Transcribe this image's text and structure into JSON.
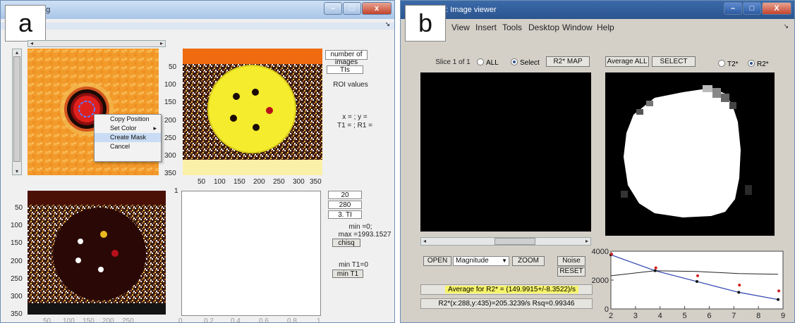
{
  "panel_a": {
    "label": "a",
    "title_fragment": "ng",
    "toolbar_fragment": ":",
    "context_menu": [
      "Copy Position",
      "Set Color",
      "Create Mask",
      "Cancel"
    ],
    "context_menu_arrow": "▸",
    "right": {
      "number_of_images": "number of images",
      "tis": "TIs",
      "roi_values": "ROI values",
      "xy": "x = ; y =",
      "t1r1": "T1 = ; R1 =",
      "box1": "20",
      "box2": "280",
      "box3": "3. TI",
      "min": "min =0;",
      "max": "max =1993.1527",
      "chisq": "chisq",
      "min_t1_text": "min T1=0",
      "min_t1_btn": "min T1"
    },
    "axis_top_y": [
      "50",
      "100",
      "150",
      "200",
      "250",
      "300",
      "350"
    ],
    "axis_top_x": [
      "50",
      "100",
      "150",
      "200",
      "250",
      "300",
      "350"
    ],
    "axis_bot_y": [
      "50",
      "100",
      "150",
      "200",
      "250",
      "300",
      "350"
    ],
    "axis_bot_x": [
      "50",
      "100",
      "150",
      "200",
      "250"
    ],
    "axis_plot_y": [
      "1"
    ],
    "axis_plot_x": [
      "0",
      "0.2",
      "0.4",
      "0.6",
      "0.8",
      "1"
    ]
  },
  "panel_b": {
    "label": "b",
    "title": "1: Image viewer",
    "menu": [
      "t",
      "View",
      "Insert",
      "Tools",
      "Desktop",
      "Window",
      "Help"
    ],
    "slice": "Slice 1 of 1",
    "all": "ALL",
    "select": "Select",
    "r2map": "R2* MAP",
    "average_all": "Average ALL",
    "select_btn": "SELECT",
    "t2star": "T2*",
    "r2star": "R2*",
    "open": "OPEN",
    "magnitude": "Magnitude",
    "zoom": "ZOOM",
    "noise": "Noise",
    "reset": "RESET",
    "average_text": "Average for R2* = (149.9915+/-8.3522)/s",
    "fit_text": "R2*(x:288,y:435)=205.3239/s Rsq=0.99346",
    "colors": {
      "highlight": "#f7f56a"
    }
  },
  "chart_data": {
    "type": "line",
    "x": [
      2,
      3.8,
      5.5,
      7.2,
      8.8
    ],
    "series": [
      {
        "values": [
          3750,
          2650,
          1900,
          1150,
          650
        ]
      },
      {
        "values": [
          3800,
          2850,
          2300,
          1650,
          1250
        ]
      }
    ],
    "xlim": [
      2,
      9
    ],
    "ylim": [
      0,
      4000
    ],
    "xticks": [
      "2",
      "3",
      "4",
      "5",
      "6",
      "7",
      "8",
      "9"
    ],
    "yticks": [
      "0",
      "2000",
      "4000"
    ]
  }
}
